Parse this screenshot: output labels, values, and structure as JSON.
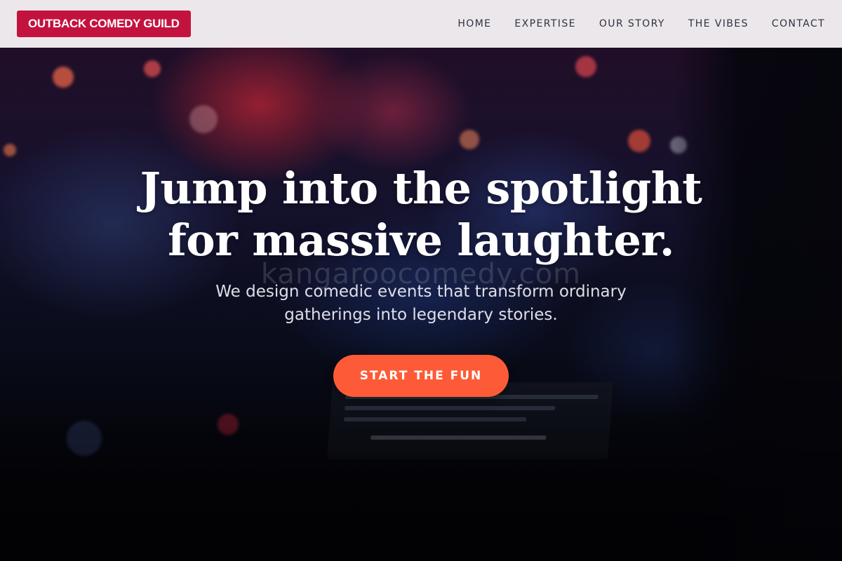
{
  "brand": {
    "name": "OUTBACK COMEDY GUILD",
    "color": "#c4123f"
  },
  "nav": {
    "items": [
      {
        "label": "HOME"
      },
      {
        "label": "EXPERTISE"
      },
      {
        "label": "OUR STORY"
      },
      {
        "label": "THE VIBES"
      },
      {
        "label": "CONTACT"
      }
    ]
  },
  "hero": {
    "title_line1": "Jump into the spotlight",
    "title_line2": "for massive laughter.",
    "watermark": "kangaroocomedy.com",
    "subtitle_line1": "We design comedic events that transform ordinary",
    "subtitle_line2": "gatherings into legendary stories.",
    "cta_label": "START THE FUN",
    "cta_color": "#fd5b37"
  }
}
